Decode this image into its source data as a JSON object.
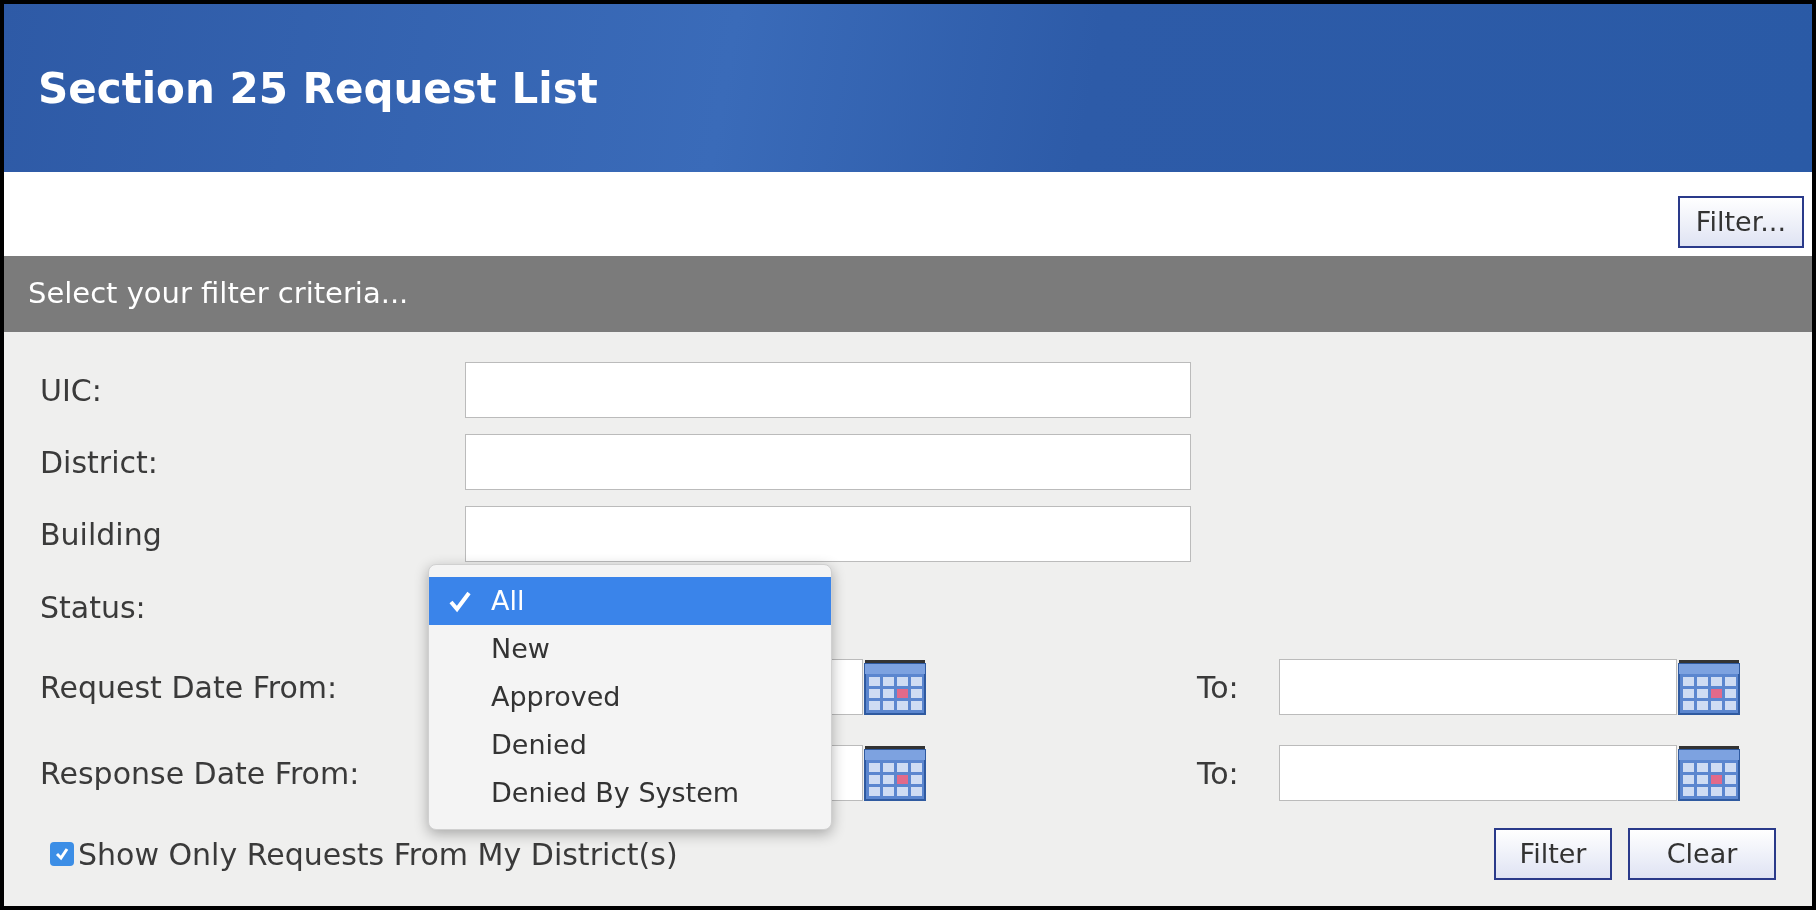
{
  "header": {
    "title": "Section 25 Request List"
  },
  "toolbar": {
    "filter_button": "Filter..."
  },
  "filter_panel": {
    "heading": "Select your filter criteria...",
    "text_fields": [
      {
        "label": "UIC:"
      },
      {
        "label": "District:"
      },
      {
        "label": "Building"
      }
    ],
    "status": {
      "label": "Status:",
      "expanded": true,
      "options": [
        {
          "label": "All",
          "selected": true
        },
        {
          "label": "New",
          "selected": false
        },
        {
          "label": "Approved",
          "selected": false
        },
        {
          "label": "Denied",
          "selected": false
        },
        {
          "label": "Denied By System",
          "selected": false
        }
      ]
    },
    "date_ranges": [
      {
        "label": "Request Date From:",
        "to_label": "To:"
      },
      {
        "label": "Response Date From:",
        "to_label": "To:"
      }
    ],
    "checkbox": {
      "label": "Show Only Requests From My District(s)",
      "checked": true
    },
    "buttons": [
      "Filter",
      "Clear"
    ]
  }
}
